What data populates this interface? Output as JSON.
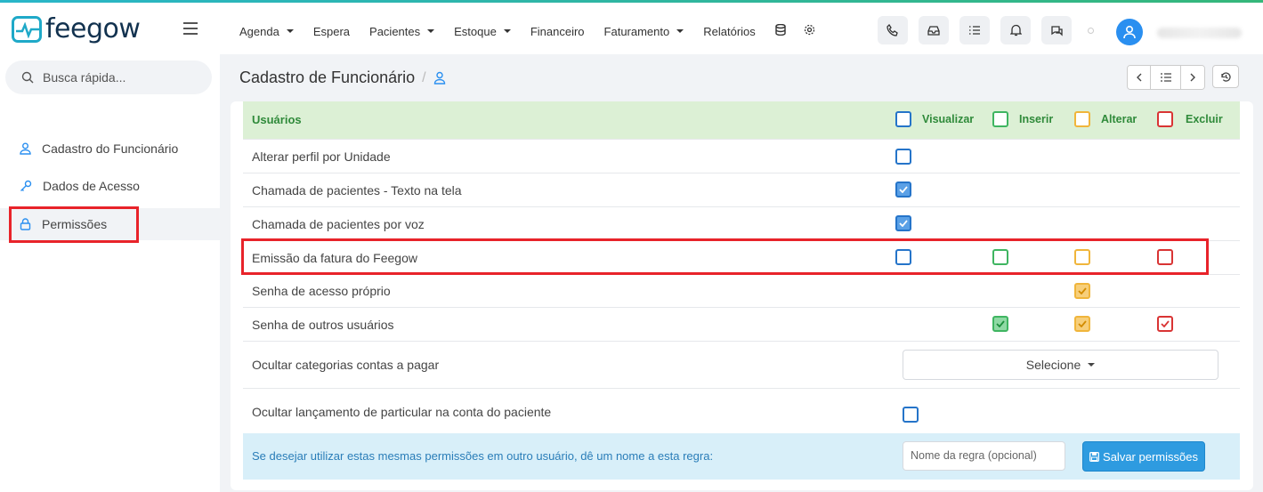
{
  "brand": {
    "name": "feegow",
    "accent": "#1fa9c8"
  },
  "nav": [
    {
      "label": "Agenda",
      "dropdown": true
    },
    {
      "label": "Espera",
      "dropdown": false
    },
    {
      "label": "Pacientes",
      "dropdown": true
    },
    {
      "label": "Estoque",
      "dropdown": true
    },
    {
      "label": "Financeiro",
      "dropdown": false
    },
    {
      "label": "Faturamento",
      "dropdown": true
    },
    {
      "label": "Relatórios",
      "dropdown": false
    }
  ],
  "nav_icons": [
    "database-icon",
    "gear-icon"
  ],
  "toolbar_icons": [
    "phone-icon",
    "inbox-icon",
    "checklist-icon",
    "bell-icon",
    "chat-icon"
  ],
  "search": {
    "placeholder": "Busca rápida..."
  },
  "sidebar": {
    "items": [
      {
        "label": "Cadastro do Funcionário",
        "icon": "user-icon",
        "active": false
      },
      {
        "label": "Dados de Acesso",
        "icon": "key-icon",
        "active": false
      },
      {
        "label": "Permissões",
        "icon": "lock-icon",
        "active": true
      }
    ]
  },
  "header": {
    "title": "Cadastro de Funcionário",
    "separator": "/"
  },
  "permissions": {
    "section_label": "Usuários",
    "columns": [
      "Visualizar",
      "Inserir",
      "Alterar",
      "Excluir"
    ],
    "rows": [
      {
        "label": "Alterar perfil por Unidade",
        "checks": [
          false,
          null,
          null,
          null
        ]
      },
      {
        "label": "Chamada de pacientes - Texto na tela",
        "checks": [
          true,
          null,
          null,
          null
        ]
      },
      {
        "label": "Chamada de pacientes por voz",
        "checks": [
          true,
          null,
          null,
          null
        ]
      },
      {
        "label": "Emissão da fatura do Feegow",
        "checks": [
          false,
          false,
          false,
          false
        ]
      },
      {
        "label": "Senha de acesso próprio",
        "checks": [
          null,
          null,
          true,
          null
        ]
      },
      {
        "label": "Senha de outros usuários",
        "checks": [
          null,
          true,
          true,
          true
        ]
      }
    ],
    "hidden_categories": {
      "label": "Ocultar categorias contas a pagar",
      "select_value": "Selecione"
    },
    "hide_private": {
      "label": "Ocultar lançamento de particular na conta do paciente",
      "checked": false
    }
  },
  "footer": {
    "text": "Se desejar utilizar estas mesmas permissões em outro usuário, dê um nome a esta regra:",
    "rule_placeholder": "Nome da regra (opcional)",
    "save_label": "Salvar permissões"
  },
  "colors": {
    "visualizar": "#2574c9",
    "inserir": "#3fb561",
    "alterar": "#f0b53b",
    "excluir": "#d93434",
    "highlight": "#e8232a"
  }
}
